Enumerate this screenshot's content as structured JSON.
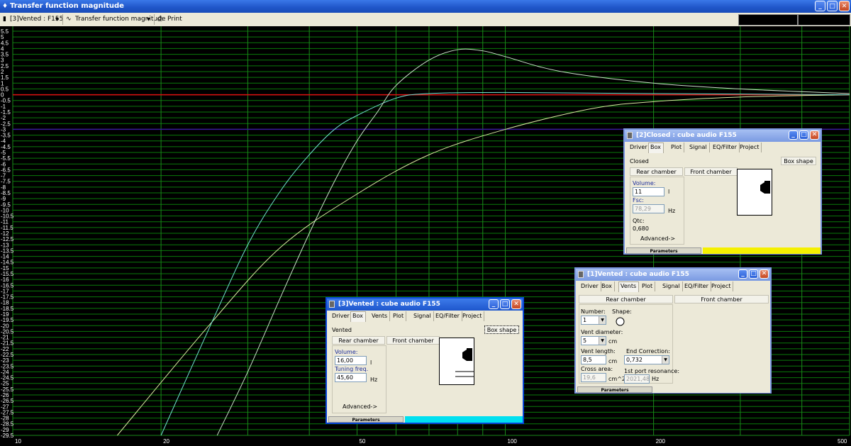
{
  "window": {
    "title": "Transfer function magnitude",
    "app_icon": "speaker-icon"
  },
  "toolbar": {
    "box_selector": "[3]Vented : F155",
    "graph_selector": "Transfer function magnitude",
    "print_label": "Print"
  },
  "plot": {
    "y_labels": [
      "5.5",
      "5",
      "4.5",
      "4",
      "3.5",
      "3",
      "2.5",
      "2",
      "1.5",
      "1",
      "0.5",
      "0",
      "-0.5",
      "-1",
      "-1.5",
      "-2",
      "-2.5",
      "-3",
      "-3.5",
      "-4",
      "-4.5",
      "-5",
      "-5.5",
      "-6",
      "-6.5",
      "-7",
      "-7.5",
      "-8",
      "-8.5",
      "-9",
      "-9.5",
      "-10",
      "-10.5",
      "-11",
      "-11.5",
      "-12",
      "-12.5",
      "-13",
      "-13.5",
      "-14",
      "-14.5",
      "-15",
      "-15.5",
      "-16",
      "-16.5",
      "-17",
      "-17.5",
      "-18",
      "-18.5",
      "-19",
      "-19.5",
      "-20",
      "-20.5",
      "-21",
      "-21.5",
      "-22",
      "-22.5",
      "-23",
      "-23.5",
      "-24",
      "-24.5",
      "-25",
      "-25.5",
      "-26",
      "-26.5",
      "-27",
      "-27.5",
      "-28",
      "-28.5",
      "-29",
      "-29.5"
    ],
    "x_labels": [
      "10",
      "20",
      "50",
      "100",
      "200",
      "500"
    ]
  },
  "chart_data": {
    "type": "line",
    "xscale": "log",
    "xlim": [
      10,
      500
    ],
    "ylim": [
      -29.5,
      5.5
    ],
    "reference_lines": [
      {
        "y": 0,
        "color": "#e01010"
      },
      {
        "y": -3,
        "color": "#3a1aa0"
      }
    ],
    "series": [
      {
        "color": "#d8e8a0",
        "points": [
          [
            16.3,
            -29.5
          ],
          [
            25,
            -20
          ],
          [
            35,
            -13.2
          ],
          [
            50,
            -8.6
          ],
          [
            70,
            -5.2
          ],
          [
            100,
            -3
          ],
          [
            150,
            -1.2
          ],
          [
            200,
            -0.6
          ],
          [
            300,
            -0.2
          ],
          [
            500,
            0
          ]
        ]
      },
      {
        "color": "#70e0d0",
        "points": [
          [
            20,
            -29.5
          ],
          [
            25,
            -20.3
          ],
          [
            30,
            -13
          ],
          [
            35,
            -8.3
          ],
          [
            40,
            -5.2
          ],
          [
            45,
            -3
          ],
          [
            50,
            -1.8
          ],
          [
            60,
            -0.3
          ],
          [
            70,
            0.1
          ],
          [
            100,
            0.2
          ],
          [
            200,
            0.1
          ],
          [
            500,
            0
          ]
        ]
      },
      {
        "color": "#c8e0c8",
        "points": [
          [
            26,
            -29.5
          ],
          [
            30,
            -24
          ],
          [
            35,
            -17.5
          ],
          [
            40,
            -12
          ],
          [
            45,
            -7.5
          ],
          [
            50,
            -4
          ],
          [
            55,
            -1.5
          ],
          [
            60,
            0.8
          ],
          [
            70,
            3
          ],
          [
            80,
            3.9
          ],
          [
            90,
            3.8
          ],
          [
            100,
            3.3
          ],
          [
            130,
            2
          ],
          [
            200,
            1
          ],
          [
            300,
            0.5
          ],
          [
            500,
            0.1
          ]
        ]
      }
    ]
  },
  "win2": {
    "title": "[2]Closed : cube audio  F155",
    "tabs": [
      "Driver",
      "Box",
      "Plot",
      "Signal",
      "EQ/Filter",
      "Project"
    ],
    "box_type": "Closed",
    "box_shape_btn": "Box shape",
    "rear_chamber": "Rear chamber",
    "front_chamber": "Front chamber",
    "volume_label": "Volume:",
    "volume_value": "11",
    "volume_unit": "l",
    "fsc_label": "Fsc:",
    "fsc_value": "78,29",
    "fsc_unit": "Hz",
    "qtc_label": "Qtc:",
    "qtc_value": "0,680",
    "advanced": "Advanced->",
    "status": "Parameters",
    "status_color": "#f5f000"
  },
  "win1": {
    "title": "[1]Vented : cube audio  F155",
    "tabs": [
      "Driver",
      "Box",
      "Vents",
      "Plot",
      "Signal",
      "EQ/Filter",
      "Project"
    ],
    "rear_chamber": "Rear chamber",
    "front_chamber": "Front chamber",
    "number_label": "Number:",
    "number_value": "1",
    "shape_label": "Shape:",
    "vent_diameter_label": "Vent diameter:",
    "vent_diameter_value": "5",
    "vent_diameter_unit": "cm",
    "vent_length_label": "Vent length:",
    "vent_length_value": "8,5",
    "vent_length_unit": "cm",
    "end_correction_label": "End Correction:",
    "end_correction_value": "0,732",
    "cross_area_label": "Cross area:",
    "cross_area_value": "19,6",
    "cross_area_unit": "cm^2",
    "port_resonance_label": "1st port resonance:",
    "port_resonance_value": "2021,48",
    "port_resonance_unit": "Hz",
    "status": "Parameters",
    "status_color": "#ece9d8"
  },
  "win3": {
    "title": "[3]Vented : cube audio  F155",
    "tabs": [
      "Driver",
      "Box",
      "Vents",
      "Plot",
      "Signal",
      "EQ/Filter",
      "Project"
    ],
    "box_type": "Vented",
    "box_shape_btn": "Box shape",
    "rear_chamber": "Rear chamber",
    "front_chamber": "Front chamber",
    "volume_label": "Volume:",
    "volume_value": "16,00",
    "volume_unit": "l",
    "tuning_label": "Tuning freq.",
    "tuning_value": "45,60",
    "tuning_unit": "Hz",
    "advanced": "Advanced->",
    "status": "Parameters",
    "status_color": "#00e0f0"
  }
}
